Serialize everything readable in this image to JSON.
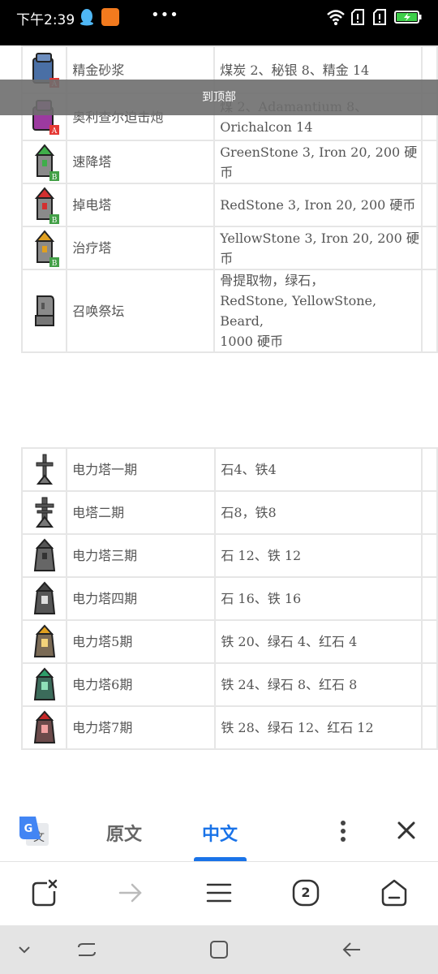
{
  "status_bar": {
    "time": "下午2:39",
    "icons": [
      "qq-icon",
      "uc-browser-icon",
      "more-dots-icon",
      "wifi-icon",
      "sim1-icon",
      "sim2-icon",
      "battery-charging-icon"
    ]
  },
  "page": {
    "to_top_label": "到顶部",
    "table1": {
      "rows": [
        {
          "name": "精金砂浆",
          "materials": "煤炭 2、秘银 8、精金 14",
          "icon": "mortar-tower-icon"
        },
        {
          "name": "奥利查尔迫击炮",
          "materials": "煤 2、Adamantium 8、\nOrichalcon 14",
          "icon": "orichalcum-mortar-icon"
        },
        {
          "name": "速降塔",
          "materials": "GreenStone 3, Iron 20, 200 硬币",
          "icon": "green-tower-icon"
        },
        {
          "name": "掉电塔",
          "materials": "RedStone 3, Iron 20, 200 硬币",
          "icon": "red-tower-icon"
        },
        {
          "name": "治疗塔",
          "materials": "YellowStone 3, Iron 20, 200 硬币",
          "icon": "yellow-tower-icon"
        },
        {
          "name": "召唤祭坛",
          "materials": "骨提取物，绿石，\nRedStone, YellowStone, Beard,\n1000 硬币",
          "icon": "summon-altar-icon"
        }
      ]
    },
    "table2": {
      "rows": [
        {
          "name": "电力塔一期",
          "materials": "石4、铁4",
          "icon": "power-tower-1-icon"
        },
        {
          "name": "电塔二期",
          "materials": "石8，铁8",
          "icon": "power-tower-2-icon"
        },
        {
          "name": "电力塔三期",
          "materials": "石 12、铁 12",
          "icon": "power-tower-3-icon"
        },
        {
          "name": "电力塔四期",
          "materials": "石 16、铁 16",
          "icon": "power-tower-4-icon"
        },
        {
          "name": "电力塔5期",
          "materials": "铁 20、绿石 4、红石 4",
          "icon": "power-tower-5-icon"
        },
        {
          "name": "电力塔6期",
          "materials": "铁 24、绿石 8、红石 8",
          "icon": "power-tower-6-icon"
        },
        {
          "name": "电力塔7期",
          "materials": "铁 28、绿石 12、红石 12",
          "icon": "power-tower-7-icon"
        }
      ]
    }
  },
  "translate_bar": {
    "original_tab": "原文",
    "chinese_tab": "中文",
    "active_tab": "中文",
    "accent_color": "#1a73e8"
  },
  "toolbar": {
    "tab_count": "2",
    "icons": [
      "new-tab-icon",
      "forward-icon",
      "menu-icon",
      "tabs-icon",
      "home-icon"
    ]
  },
  "navbar": {
    "icons": [
      "nav-collapse-icon",
      "nav-recent-icon",
      "nav-home-icon",
      "nav-back-icon"
    ]
  }
}
